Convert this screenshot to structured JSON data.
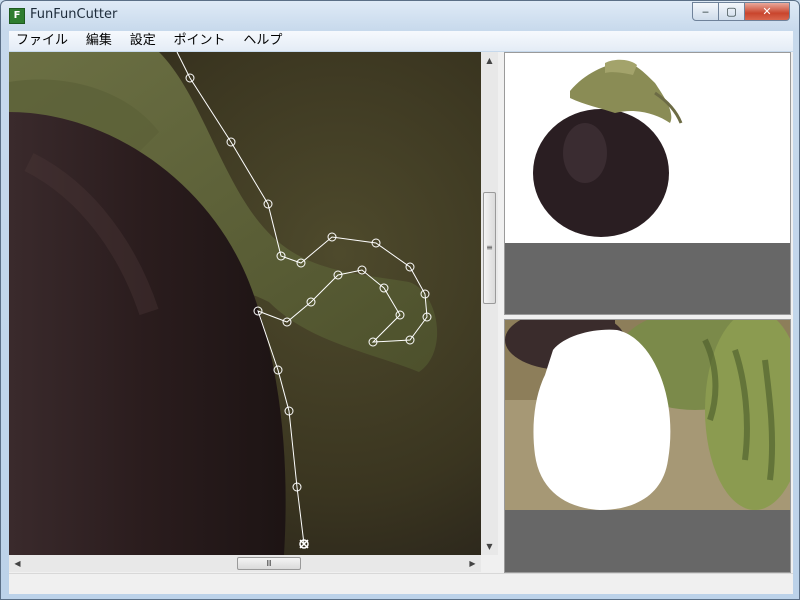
{
  "window": {
    "title": "FunFunCutter",
    "app_icon_glyph": "F",
    "controls": {
      "minimize": "‒",
      "maximize": "▢",
      "close": "✕"
    }
  },
  "menu": [
    {
      "label": "ファイル"
    },
    {
      "label": "編集"
    },
    {
      "label": "設定"
    },
    {
      "label": "ポイント"
    },
    {
      "label": "ヘルプ"
    }
  ],
  "scrollbars": {
    "up_arrow": "▲",
    "down_arrow": "▼",
    "left_arrow": "◀",
    "right_arrow": "▶",
    "grip": "≡",
    "hgrip": "Ⅲ"
  },
  "colors": {
    "path_line": "#ffffff",
    "background_dark": "#2a2518",
    "preview_gray": "#676767"
  }
}
